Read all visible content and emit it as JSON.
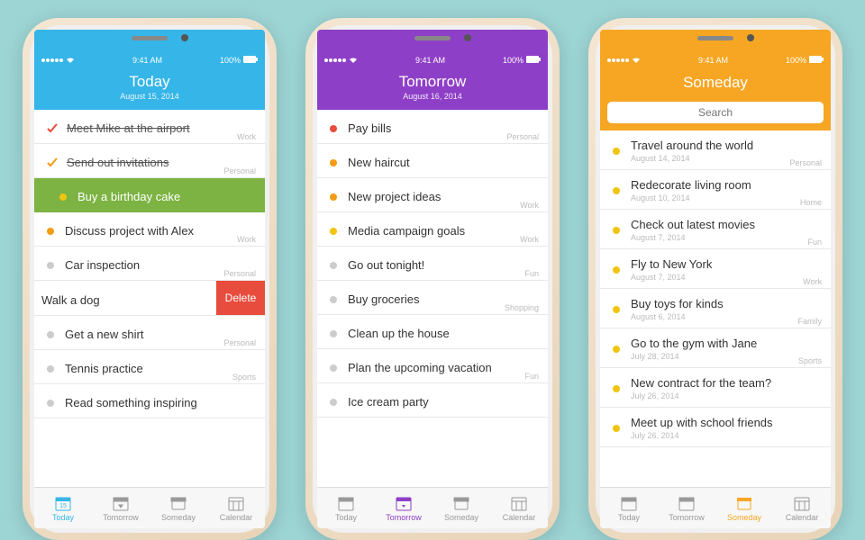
{
  "status": {
    "time": "9:41 AM",
    "battery": "100%"
  },
  "tabs": {
    "today": "Today",
    "tomorrow": "Tomorrow",
    "someday": "Someday",
    "calendar": "Calendar"
  },
  "phone1": {
    "title": "Today",
    "subtitle": "August 15, 2014",
    "items": [
      {
        "text": "Meet Mike at the airport",
        "tag": "Work",
        "done": true,
        "check_color": "#e74c3c"
      },
      {
        "text": "Send out invitations",
        "tag": "Personal",
        "done": true,
        "check_color": "#f39c12"
      },
      {
        "text": "Buy a birthday cake",
        "highlighted": true,
        "dot": "#f1c40f"
      },
      {
        "text": "Discuss project with Alex",
        "tag": "Work",
        "dot": "#f39c12"
      },
      {
        "text": "Car inspection",
        "tag": "Personal",
        "dot": "#ccc"
      },
      {
        "text": "Walk a dog",
        "swipe_delete": true
      },
      {
        "text": "Get a new shirt",
        "tag": "Personal",
        "dot": "#ccc"
      },
      {
        "text": "Tennis practice",
        "tag": "Sports",
        "dot": "#ccc"
      },
      {
        "text": "Read something inspiring",
        "dot": "#ccc"
      }
    ],
    "delete_label": "Delete"
  },
  "phone2": {
    "title": "Tomorrow",
    "subtitle": "August 16, 2014",
    "items": [
      {
        "text": "Pay bills",
        "tag": "Personal",
        "dot": "#e74c3c"
      },
      {
        "text": "New haircut",
        "dot": "#f39c12"
      },
      {
        "text": "New project ideas",
        "tag": "Work",
        "dot": "#f39c12"
      },
      {
        "text": "Media campaign goals",
        "tag": "Work",
        "dot": "#f1c40f"
      },
      {
        "text": "Go out tonight!",
        "tag": "Fun",
        "dot": "#ccc"
      },
      {
        "text": "Buy groceries",
        "tag": "Shopping",
        "dot": "#ccc"
      },
      {
        "text": "Clean up the house",
        "dot": "#ccc"
      },
      {
        "text": "Plan the upcoming vacation",
        "tag": "Fun",
        "dot": "#ccc"
      },
      {
        "text": "Ice cream party",
        "dot": "#ccc"
      }
    ]
  },
  "phone3": {
    "title": "Someday",
    "search_placeholder": "Search",
    "items": [
      {
        "text": "Travel around the world",
        "date": "August 14, 2014",
        "tag": "Personal",
        "dot": "#f1c40f"
      },
      {
        "text": "Redecorate living room",
        "date": "August 10, 2014",
        "tag": "Home",
        "dot": "#f1c40f"
      },
      {
        "text": "Check out latest movies",
        "date": "August 7, 2014",
        "tag": "Fun",
        "dot": "#f1c40f"
      },
      {
        "text": "Fly to New York",
        "date": "August 7, 2014",
        "tag": "Work",
        "dot": "#f1c40f"
      },
      {
        "text": "Buy toys for kinds",
        "date": "August 6, 2014",
        "tag": "Family",
        "dot": "#f1c40f"
      },
      {
        "text": "Go to the gym with Jane",
        "date": "July 28, 2014",
        "tag": "Sports",
        "dot": "#f1c40f"
      },
      {
        "text": "New contract for the team?",
        "date": "July 26, 2014",
        "dot": "#f1c40f"
      },
      {
        "text": "Meet up with school friends",
        "date": "July 26, 2014",
        "dot": "#f1c40f"
      }
    ]
  }
}
